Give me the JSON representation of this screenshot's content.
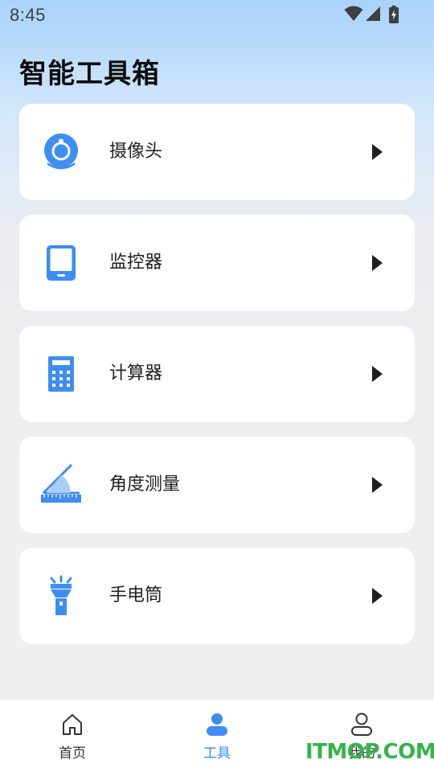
{
  "status_bar": {
    "time": "8:45",
    "icons": [
      "wifi-icon",
      "signal-icon",
      "battery-charging-icon"
    ]
  },
  "page_title": "智能工具箱",
  "accent_color": "#3d8ef0",
  "tools": [
    {
      "label": "摄像头",
      "icon": "camera-icon"
    },
    {
      "label": "监控器",
      "icon": "tablet-icon"
    },
    {
      "label": "计算器",
      "icon": "calculator-icon"
    },
    {
      "label": "角度测量",
      "icon": "protractor-icon"
    },
    {
      "label": "手电筒",
      "icon": "flashlight-icon"
    }
  ],
  "bottom_nav": {
    "items": [
      {
        "label": "首页",
        "icon": "home-icon",
        "active": false
      },
      {
        "label": "工具",
        "icon": "user-filled-icon",
        "active": true
      },
      {
        "label": "我的",
        "icon": "user-outline-icon",
        "active": false
      }
    ]
  },
  "watermark": "ITMOP.COM"
}
